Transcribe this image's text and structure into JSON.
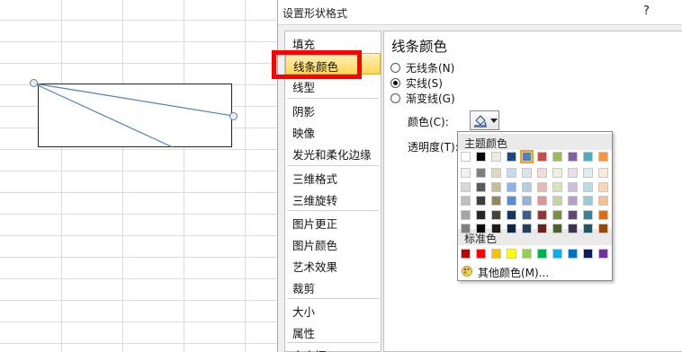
{
  "dialog": {
    "title": "设置形状格式",
    "help": "?"
  },
  "nav": {
    "items": [
      {
        "label": "填充"
      },
      {
        "label": "线条颜色",
        "selected": true
      },
      {
        "label": "线型"
      },
      {
        "label": "阴影"
      },
      {
        "label": "映像"
      },
      {
        "label": "发光和柔化边缘"
      },
      {
        "label": "三维格式"
      },
      {
        "label": "三维旋转"
      },
      {
        "label": "图片更正"
      },
      {
        "label": "图片颜色"
      },
      {
        "label": "艺术效果"
      },
      {
        "label": "裁剪"
      },
      {
        "label": "大小"
      },
      {
        "label": "属性"
      },
      {
        "label": "文本框"
      }
    ]
  },
  "panel": {
    "title": "线条颜色",
    "options": [
      {
        "label": "无线条(N)",
        "checked": false
      },
      {
        "label": "实线(S)",
        "checked": true
      },
      {
        "label": "渐变线(G)",
        "checked": false
      }
    ],
    "color_label": "颜色(C):",
    "transparency_label": "透明度(T):"
  },
  "picker": {
    "theme_label": "主题颜色",
    "standard_label": "标准色",
    "more_label": "其他颜色(M)...",
    "theme_top": [
      "#ffffff",
      "#000000",
      "#eeece1",
      "#1f497d",
      "#4f81bd",
      "#c0504d",
      "#9bbb59",
      "#8064a2",
      "#4bacc6",
      "#f79646"
    ],
    "theme_shades": [
      [
        "#f2f2f2",
        "#7f7f7f",
        "#ddd9c3",
        "#c6d9f0",
        "#dbe5f1",
        "#f2dcdb",
        "#ebf1dd",
        "#e5e0ec",
        "#dbeef3",
        "#fdeada"
      ],
      [
        "#d8d8d8",
        "#595959",
        "#c4bd97",
        "#8db3e2",
        "#b8cce4",
        "#e5b9b7",
        "#d7e3bc",
        "#ccc1d9",
        "#b7dde8",
        "#fbd5b5"
      ],
      [
        "#bfbfbf",
        "#3f3f3f",
        "#938953",
        "#548dd4",
        "#95b3d7",
        "#d99694",
        "#c3d69b",
        "#b2a2c7",
        "#92cddc",
        "#fac08f"
      ],
      [
        "#a5a5a5",
        "#262626",
        "#494429",
        "#17365d",
        "#366092",
        "#953734",
        "#76923c",
        "#5f497a",
        "#31859b",
        "#e36c09"
      ],
      [
        "#7f7f7f",
        "#0c0c0c",
        "#1d1b10",
        "#0f243e",
        "#244061",
        "#632423",
        "#4f6128",
        "#3f3151",
        "#205867",
        "#974806"
      ]
    ],
    "standard": [
      "#c00000",
      "#ff0000",
      "#ffc000",
      "#ffff00",
      "#92d050",
      "#00b050",
      "#00b0f0",
      "#0070c0",
      "#002060",
      "#7030a0"
    ],
    "selected_color": "#4f81bd"
  }
}
